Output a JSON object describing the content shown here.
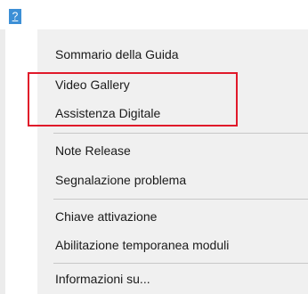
{
  "menubar": {
    "help_label": "?"
  },
  "dropdown": {
    "items": [
      {
        "label": "Sommario della Guida"
      },
      {
        "label": "Video Gallery"
      },
      {
        "label": "Assistenza Digitale"
      },
      {
        "label": "Note Release"
      },
      {
        "label": "Segnalazione problema"
      },
      {
        "label": "Chiave attivazione"
      },
      {
        "label": "Abilitazione temporanea moduli"
      },
      {
        "label": "Informazioni su..."
      }
    ]
  },
  "highlight": {
    "color": "#e0192a"
  }
}
